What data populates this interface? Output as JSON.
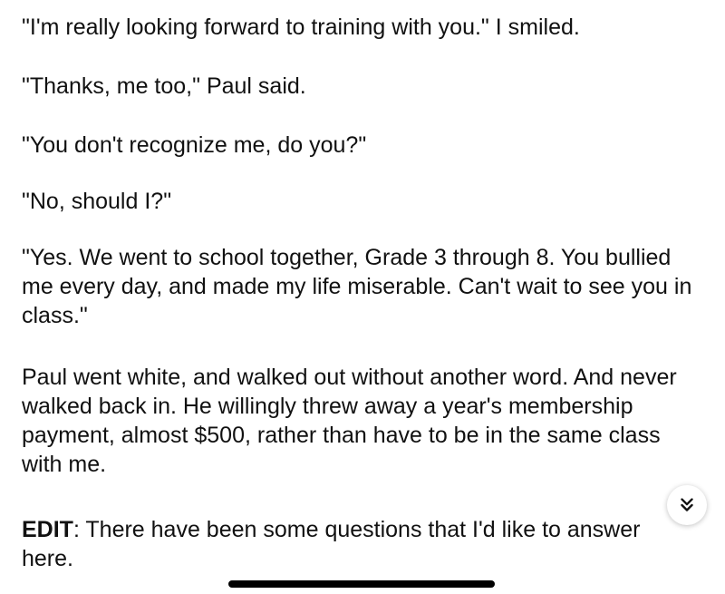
{
  "story": {
    "paragraphs": [
      "\"I'm really looking forward to training with you.\" I smiled.",
      "\"Thanks, me too,\" Paul said.",
      "\"You don't recognize me, do you?\"",
      "\"No, should I?\"",
      "\"Yes. We went to school together, Grade 3 through 8. You bullied me every day, and made my life miserable. Can't wait to see you in class.\"",
      "Paul went white, and walked out without another word. And never walked back in. He willingly threw away a year's membership payment, almost $500, rather than have to be in the same class with me."
    ],
    "edit": {
      "label": "EDIT",
      "text": ": There have been some questions that I'd like to answer here."
    }
  },
  "controls": {
    "scroll_down_icon": "double-chevron-down-icon"
  }
}
